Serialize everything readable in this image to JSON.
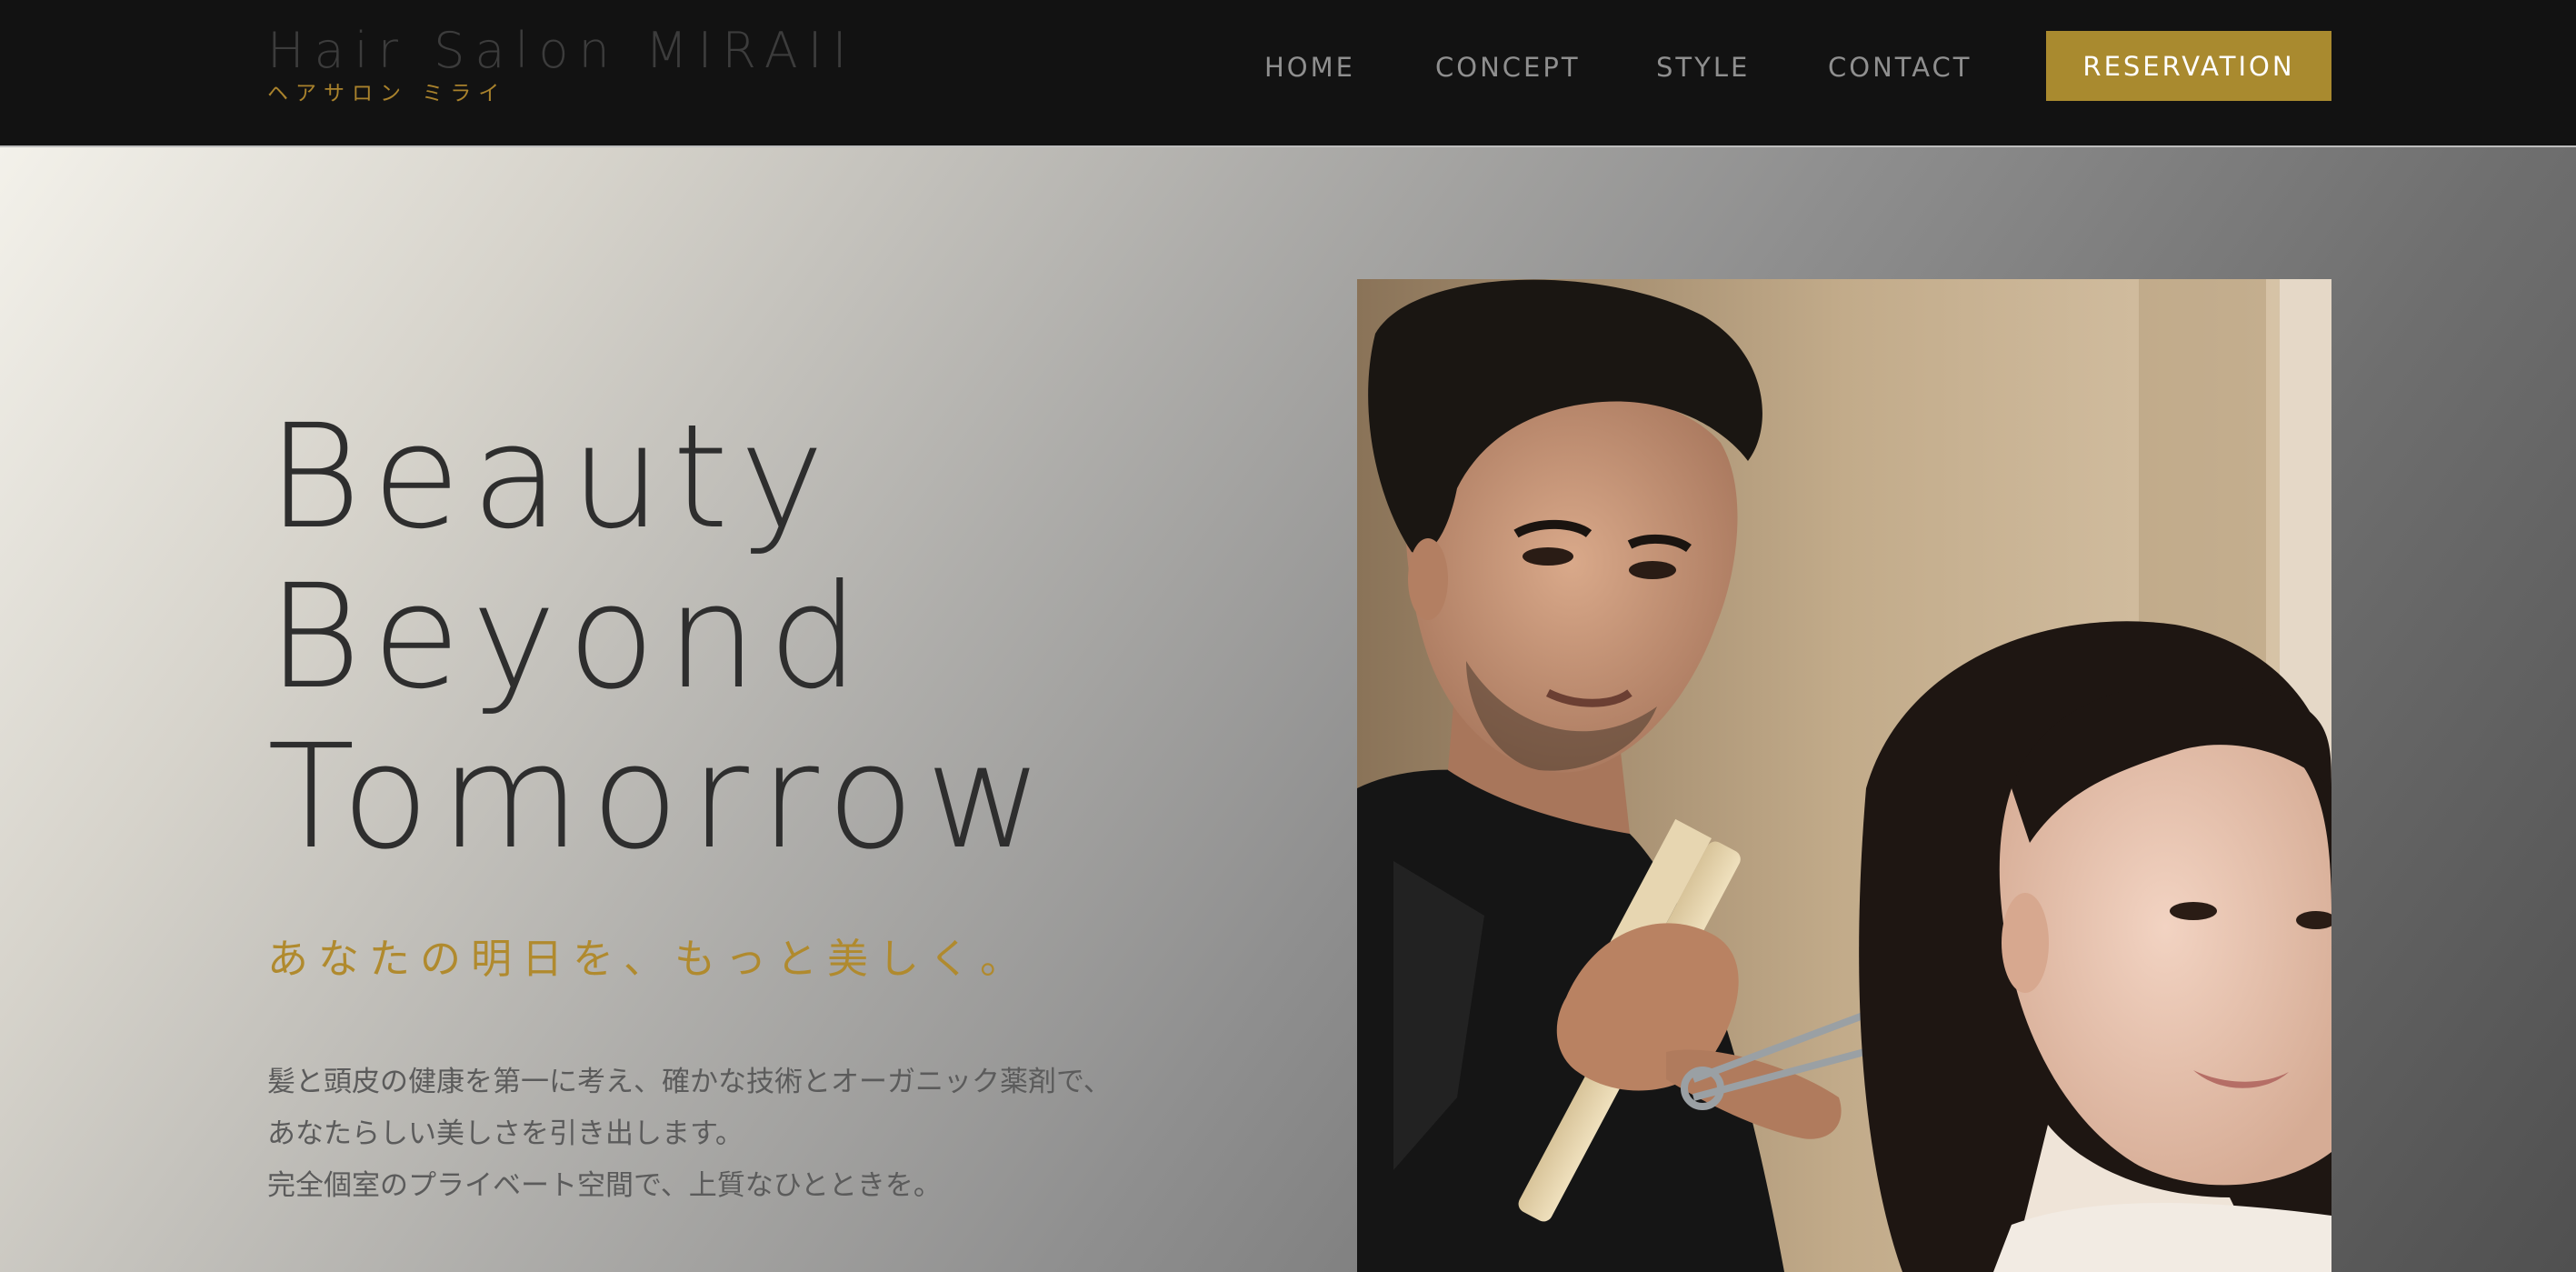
{
  "header": {
    "logo_title": "Hair Salon MIRAII",
    "logo_subtitle": "ヘアサロン ミライ",
    "nav": {
      "home": "HOME",
      "concept": "CONCEPT",
      "style": "STYLE",
      "contact": "CONTACT"
    },
    "reservation_label": "RESERVATION"
  },
  "hero": {
    "title_lines": [
      "Beauty",
      "Beyond",
      "Tomorrow"
    ],
    "tagline": "あなたの明日を、もっと美しく。",
    "body_lines": [
      "髪と頭皮の健康を第一に考え、確かな技術とオーガニック薬剤で、",
      "あなたらしい美しさを引き出します。",
      "完全個室のプライベート空間で、上質なひとときを。"
    ]
  },
  "colors": {
    "header_bg": "#121212",
    "accent_gold": "#a98a2f",
    "nav_text": "#8f8f8f",
    "title_text": "#2e2e2e",
    "tagline_text": "#b08a2e",
    "body_text": "#5b5b5b"
  }
}
